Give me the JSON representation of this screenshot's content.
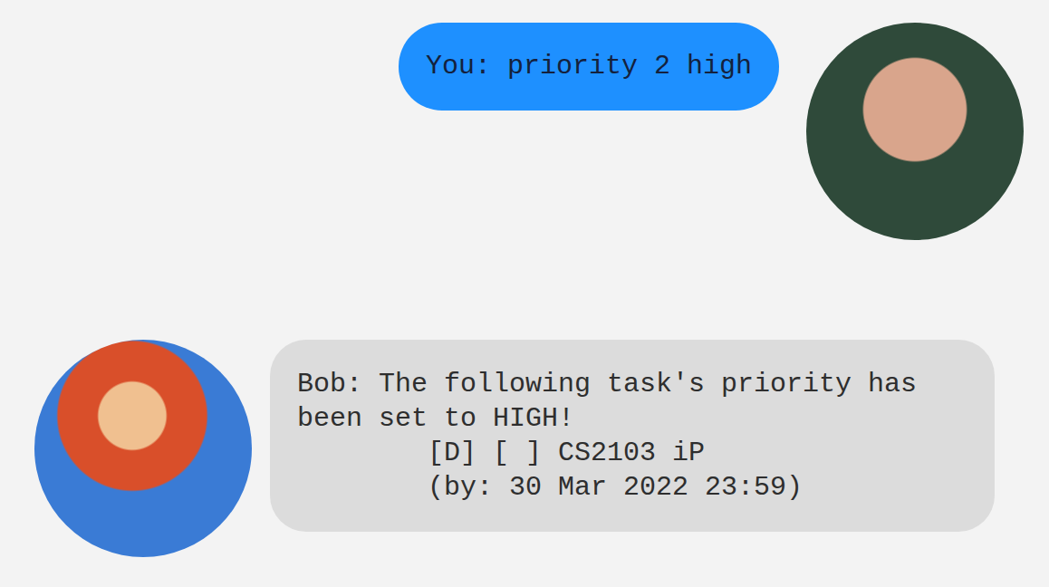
{
  "messages": [
    {
      "kind": "user",
      "text": "You: priority 2 high"
    },
    {
      "kind": "bot",
      "text": "Bob: The following task's priority has been set to HIGH!\n\t[D] [ ] CS2103 iP\n\t(by: 30 Mar 2022 23:59)"
    }
  ]
}
